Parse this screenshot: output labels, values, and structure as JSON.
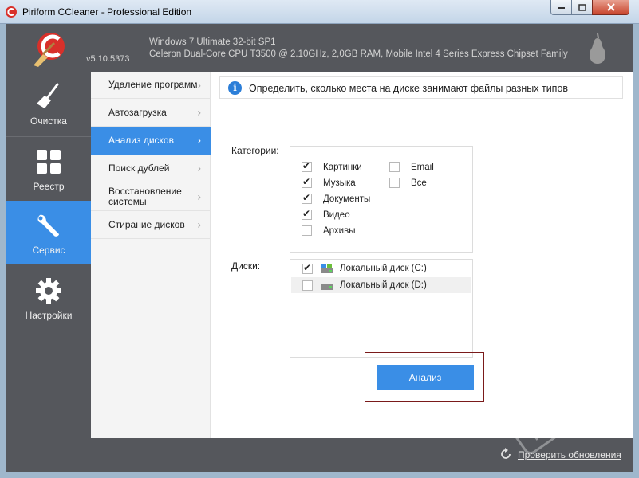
{
  "window": {
    "title": "Piriform CCleaner - Professional Edition"
  },
  "header": {
    "version": "v5.10.5373",
    "os_info": "Windows 7 Ultimate 32-bit SP1",
    "hw_info": "Celeron Dual-Core CPU T3500 @ 2.10GHz, 2,0GB RAM, Mobile Intel 4 Series Express Chipset Family"
  },
  "nav": {
    "items": [
      {
        "label": "Очистка",
        "icon": "broom-icon"
      },
      {
        "label": "Реестр",
        "icon": "grid-icon"
      },
      {
        "label": "Сервис",
        "icon": "wrench-icon",
        "active": true
      },
      {
        "label": "Настройки",
        "icon": "gear-icon"
      }
    ]
  },
  "subnav": {
    "items": [
      {
        "label": "Удаление программ"
      },
      {
        "label": "Автозагрузка"
      },
      {
        "label": "Анализ дисков",
        "active": true
      },
      {
        "label": "Поиск дублей"
      },
      {
        "label": "Восстановление системы"
      },
      {
        "label": "Стирание дисков"
      }
    ]
  },
  "content": {
    "info_text": "Определить, сколько места на диске занимают файлы разных типов",
    "categories_label": "Категории:",
    "categories": [
      {
        "label": "Картинки",
        "checked": true
      },
      {
        "label": "Музыка",
        "checked": true
      },
      {
        "label": "Документы",
        "checked": true
      },
      {
        "label": "Видео",
        "checked": true
      },
      {
        "label": "Архивы",
        "checked": false
      },
      {
        "label": "Email",
        "checked": false
      },
      {
        "label": "Все",
        "checked": false
      }
    ],
    "disks_label": "Диски:",
    "disks": [
      {
        "label": "Локальный диск (C:)",
        "checked": true
      },
      {
        "label": "Локальный диск (D:)",
        "checked": false
      }
    ],
    "analyze_label": "Анализ"
  },
  "footer": {
    "update_link": "Проверить обновления"
  },
  "colors": {
    "accent": "#3a8ee6",
    "dark_panel": "#55575c",
    "highlight_border": "#7a1a1a"
  }
}
